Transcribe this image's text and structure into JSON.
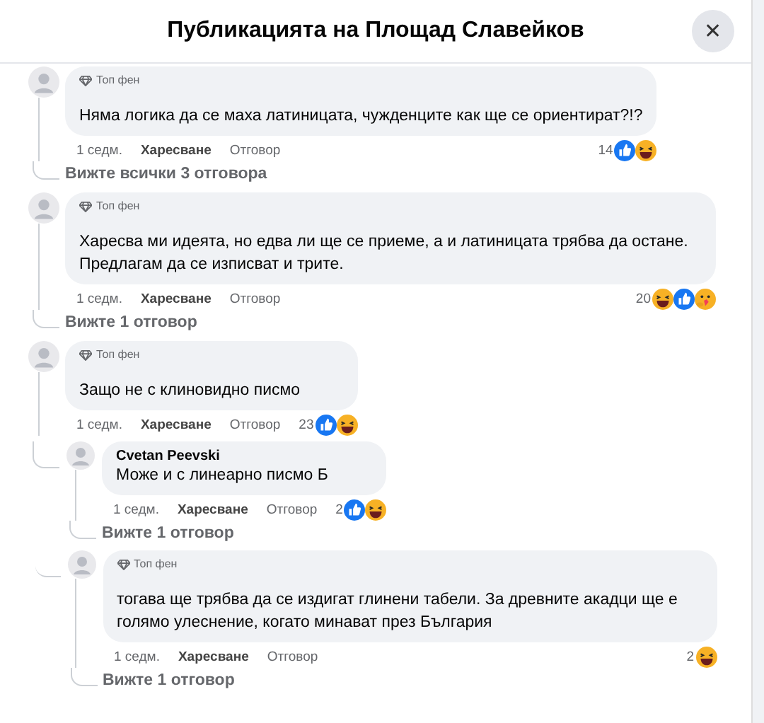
{
  "dialog": {
    "title": "Публикацията на Площад Славейков",
    "close": "✕"
  },
  "comments": [
    {
      "badge": "Топ фен",
      "text": "Няма логика да се маха латиницата, чужденците как ще се ориентират?!?",
      "time": "1 седм.",
      "like": "Харесване",
      "reply": "Отговор",
      "count": "14",
      "reactions": [
        {
          "kind": "like"
        },
        {
          "kind": "haha"
        }
      ],
      "wide": false,
      "view_replies": "Вижте всички 3 отговора"
    },
    {
      "badge": "Топ фен",
      "text": "Харесва ми идеята, но едва ли ще се приеме, а и латиницата трябва да остане. Предлагам да се изписват и трите.",
      "time": "1 седм.",
      "like": "Харесване",
      "reply": "Отговор",
      "count": "20",
      "reactions": [
        {
          "kind": "haha"
        },
        {
          "kind": "like"
        },
        {
          "kind": "care"
        }
      ],
      "wide": true,
      "view_replies": "Вижте 1 отговор"
    },
    {
      "badge": "Топ фен",
      "text": "Защо не с клиновидно писмо",
      "time": "1 седм.",
      "like": "Харесване",
      "reply": "Отговор",
      "count": "23",
      "reactions": [
        {
          "kind": "like"
        },
        {
          "kind": "haha"
        }
      ],
      "wide": false,
      "replies": [
        {
          "name": "Cvetan Peevski",
          "text": "Може и с линеарно писмо Б",
          "time": "1 седм.",
          "like": "Харесване",
          "reply": "Отговор",
          "count": "2",
          "reactions": [
            {
              "kind": "like"
            },
            {
              "kind": "haha"
            }
          ],
          "wide": false,
          "view_replies": "Вижте 1 отговор"
        },
        {
          "badge": "Топ фен",
          "text": "тогава ще трябва да се издигат глинени табели. За древните акадци ще е голямо улеснение, когато минават през България",
          "time": "1 седм.",
          "like": "Харесване",
          "reply": "Отговор",
          "count": "2",
          "reactions": [
            {
              "kind": "haha"
            }
          ],
          "wide": true,
          "view_replies": "Вижте 1 отговор"
        }
      ]
    }
  ]
}
